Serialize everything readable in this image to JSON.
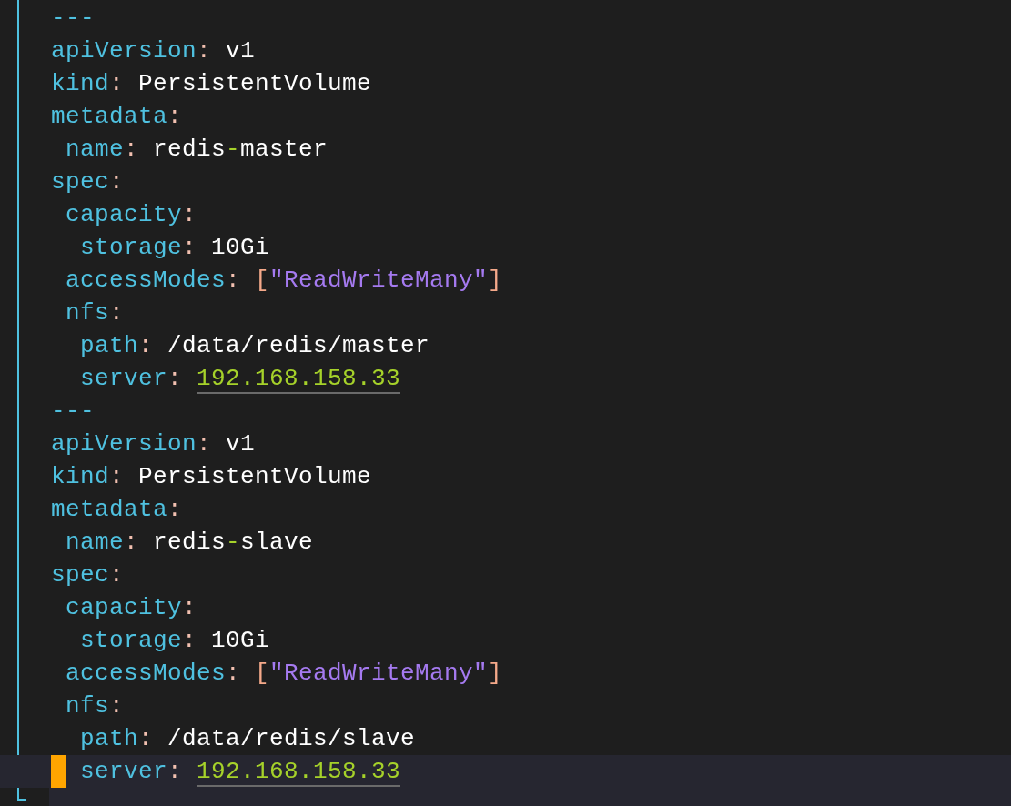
{
  "editor": {
    "lines": [
      {
        "current": false,
        "tokens": [
          {
            "kind": "dash",
            "text": "---"
          }
        ]
      },
      {
        "current": false,
        "tokens": [
          {
            "kind": "key",
            "text": "apiVersion"
          },
          {
            "kind": "colon",
            "text": ":"
          },
          {
            "kind": "plain",
            "text": " v1"
          }
        ]
      },
      {
        "current": false,
        "tokens": [
          {
            "kind": "key",
            "text": "kind"
          },
          {
            "kind": "colon",
            "text": ":"
          },
          {
            "kind": "plain",
            "text": " PersistentVolume"
          }
        ]
      },
      {
        "current": false,
        "tokens": [
          {
            "kind": "key",
            "text": "metadata"
          },
          {
            "kind": "colon",
            "text": ":"
          }
        ]
      },
      {
        "current": false,
        "tokens": [
          {
            "kind": "key",
            "text": " name"
          },
          {
            "kind": "colon",
            "text": ":"
          },
          {
            "kind": "plain",
            "text": " redis"
          },
          {
            "kind": "operator",
            "text": "-"
          },
          {
            "kind": "plain",
            "text": "master"
          }
        ]
      },
      {
        "current": false,
        "tokens": [
          {
            "kind": "key",
            "text": "spec"
          },
          {
            "kind": "colon",
            "text": ":"
          }
        ]
      },
      {
        "current": false,
        "tokens": [
          {
            "kind": "key",
            "text": " capacity"
          },
          {
            "kind": "colon",
            "text": ":"
          }
        ]
      },
      {
        "current": false,
        "tokens": [
          {
            "kind": "key",
            "text": "  storage"
          },
          {
            "kind": "colon",
            "text": ":"
          },
          {
            "kind": "plain",
            "text": " 10Gi"
          }
        ]
      },
      {
        "current": false,
        "tokens": [
          {
            "kind": "key",
            "text": " accessModes"
          },
          {
            "kind": "colon",
            "text": ": "
          },
          {
            "kind": "bracket",
            "text": "["
          },
          {
            "kind": "string",
            "text": "\"ReadWriteMany\""
          },
          {
            "kind": "bracket",
            "text": "]"
          }
        ]
      },
      {
        "current": false,
        "tokens": [
          {
            "kind": "key",
            "text": " nfs"
          },
          {
            "kind": "colon",
            "text": ":"
          }
        ]
      },
      {
        "current": false,
        "tokens": [
          {
            "kind": "key",
            "text": "  path"
          },
          {
            "kind": "colon",
            "text": ":"
          },
          {
            "kind": "plain",
            "text": " /data/redis/master"
          }
        ]
      },
      {
        "current": false,
        "tokens": [
          {
            "kind": "key",
            "text": "  server"
          },
          {
            "kind": "colon",
            "text": ": "
          },
          {
            "kind": "number",
            "text": "192.168.158.33"
          }
        ]
      },
      {
        "current": false,
        "tokens": [
          {
            "kind": "dash",
            "text": "---"
          }
        ]
      },
      {
        "current": false,
        "tokens": [
          {
            "kind": "key",
            "text": "apiVersion"
          },
          {
            "kind": "colon",
            "text": ":"
          },
          {
            "kind": "plain",
            "text": " v1"
          }
        ]
      },
      {
        "current": false,
        "tokens": [
          {
            "kind": "key",
            "text": "kind"
          },
          {
            "kind": "colon",
            "text": ":"
          },
          {
            "kind": "plain",
            "text": " PersistentVolume"
          }
        ]
      },
      {
        "current": false,
        "tokens": [
          {
            "kind": "key",
            "text": "metadata"
          },
          {
            "kind": "colon",
            "text": ":"
          }
        ]
      },
      {
        "current": false,
        "tokens": [
          {
            "kind": "key",
            "text": " name"
          },
          {
            "kind": "colon",
            "text": ":"
          },
          {
            "kind": "plain",
            "text": " redis"
          },
          {
            "kind": "operator",
            "text": "-"
          },
          {
            "kind": "plain",
            "text": "slave"
          }
        ]
      },
      {
        "current": false,
        "tokens": [
          {
            "kind": "key",
            "text": "spec"
          },
          {
            "kind": "colon",
            "text": ":"
          }
        ]
      },
      {
        "current": false,
        "tokens": [
          {
            "kind": "key",
            "text": " capacity"
          },
          {
            "kind": "colon",
            "text": ":"
          }
        ]
      },
      {
        "current": false,
        "tokens": [
          {
            "kind": "key",
            "text": "  storage"
          },
          {
            "kind": "colon",
            "text": ":"
          },
          {
            "kind": "plain",
            "text": " 10Gi"
          }
        ]
      },
      {
        "current": false,
        "tokens": [
          {
            "kind": "key",
            "text": " accessModes"
          },
          {
            "kind": "colon",
            "text": ": "
          },
          {
            "kind": "bracket",
            "text": "["
          },
          {
            "kind": "string",
            "text": "\"ReadWriteMany\""
          },
          {
            "kind": "bracket",
            "text": "]"
          }
        ]
      },
      {
        "current": false,
        "tokens": [
          {
            "kind": "key",
            "text": " nfs"
          },
          {
            "kind": "colon",
            "text": ":"
          }
        ]
      },
      {
        "current": false,
        "tokens": [
          {
            "kind": "key",
            "text": "  path"
          },
          {
            "kind": "colon",
            "text": ":"
          },
          {
            "kind": "plain",
            "text": " /data/redis/slave"
          }
        ]
      },
      {
        "current": true,
        "tokens": [
          {
            "kind": "key",
            "text": "  server"
          },
          {
            "kind": "colon",
            "text": ": "
          },
          {
            "kind": "number",
            "text": "192.168.158.33"
          }
        ]
      }
    ]
  }
}
